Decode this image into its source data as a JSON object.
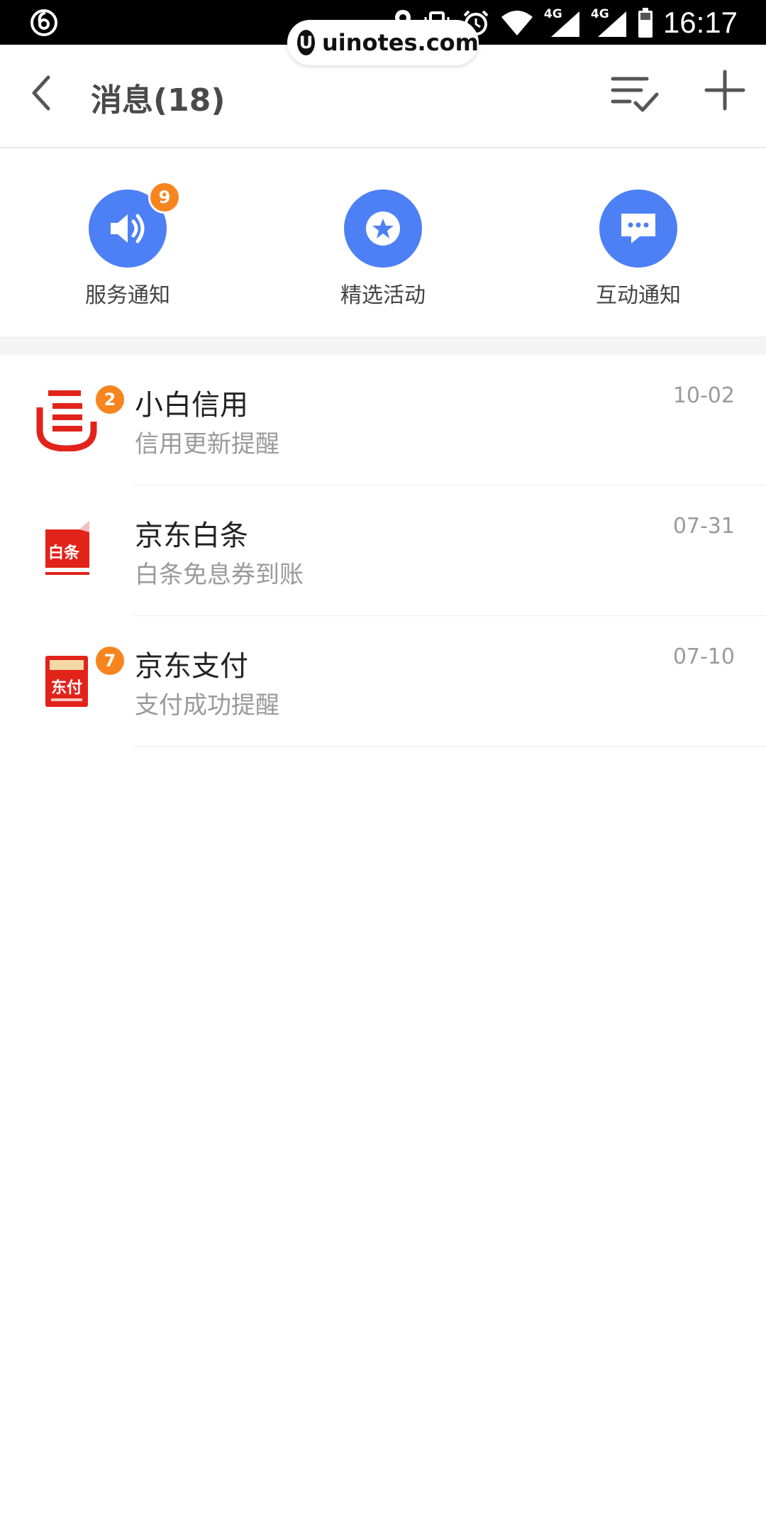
{
  "status_bar": {
    "time": "16:17",
    "network_1": "4G",
    "network_2": "4G"
  },
  "watermark": {
    "logo_letter": "U",
    "text": "uinotes.com"
  },
  "header": {
    "title": "消息(18)",
    "icons": {
      "back": "back-arrow-icon",
      "mark_read": "mark-all-read-icon",
      "add": "plus-icon"
    }
  },
  "categories": [
    {
      "label": "服务通知",
      "icon": "speaker-icon",
      "badge": "9"
    },
    {
      "label": "精选活动",
      "icon": "star-icon",
      "badge": ""
    },
    {
      "label": "互动通知",
      "icon": "chat-bubble-icon",
      "badge": ""
    }
  ],
  "messages": [
    {
      "title": "小白信用",
      "subtitle": "信用更新提醒",
      "date": "10-02",
      "badge": "2",
      "logo": "xiaobai-credit-logo"
    },
    {
      "title": "京东白条",
      "subtitle": "白条免息券到账",
      "date": "07-31",
      "badge": "",
      "logo": "jd-baitiao-logo",
      "logo_text": "白条"
    },
    {
      "title": "京东支付",
      "subtitle": "支付成功提醒",
      "date": "07-10",
      "badge": "7",
      "logo": "jd-pay-logo",
      "logo_text": "东付"
    }
  ],
  "colors": {
    "accent_blue": "#4e80f5",
    "badge_orange": "#f7851f",
    "brand_red": "#e2231a"
  }
}
